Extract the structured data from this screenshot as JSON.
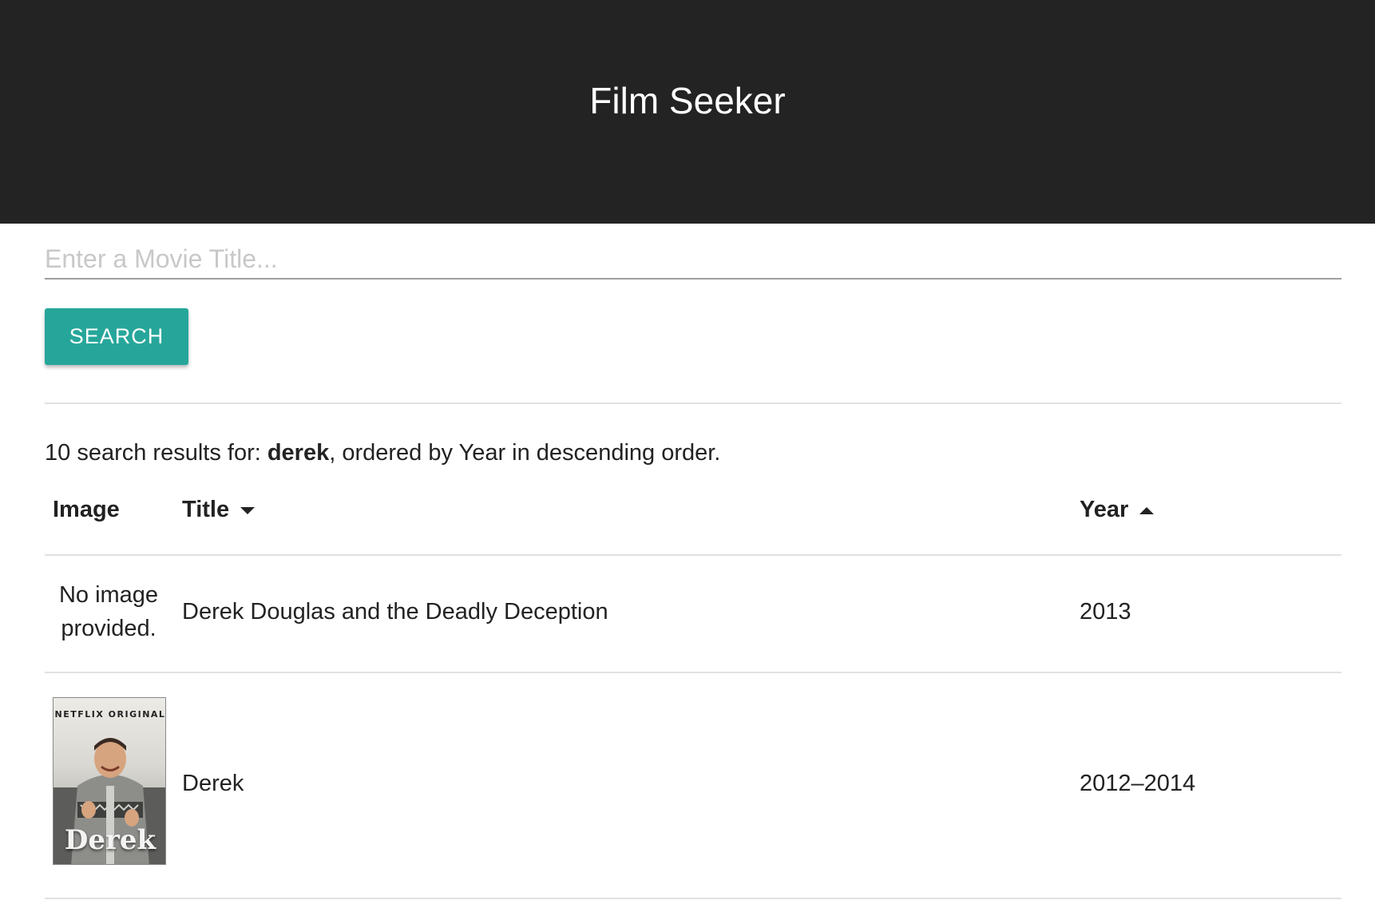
{
  "header": {
    "title": "Film Seeker"
  },
  "search": {
    "placeholder": "Enter a Movie Title...",
    "value": "",
    "button_label": "SEARCH"
  },
  "summary": {
    "prefix": "10 search results for: ",
    "query": "derek",
    "suffix": ", ordered by Year in descending order."
  },
  "table": {
    "columns": {
      "image": "Image",
      "title": "Title",
      "year": "Year"
    },
    "sort": {
      "title_indicator": "caret-down",
      "year_indicator": "caret-up"
    },
    "rows": [
      {
        "image_text_line1": "No image",
        "image_text_line2": "provided.",
        "title": "Derek Douglas and the Deadly Deception",
        "year": "2013"
      },
      {
        "poster_brand": "NETFLIX ORIGINAL",
        "poster_title": "Derek",
        "title": "Derek",
        "year": "2012–2014"
      }
    ]
  },
  "colors": {
    "header_bg": "#232323",
    "accent": "#26a69a",
    "divider": "#e1e1e1"
  }
}
